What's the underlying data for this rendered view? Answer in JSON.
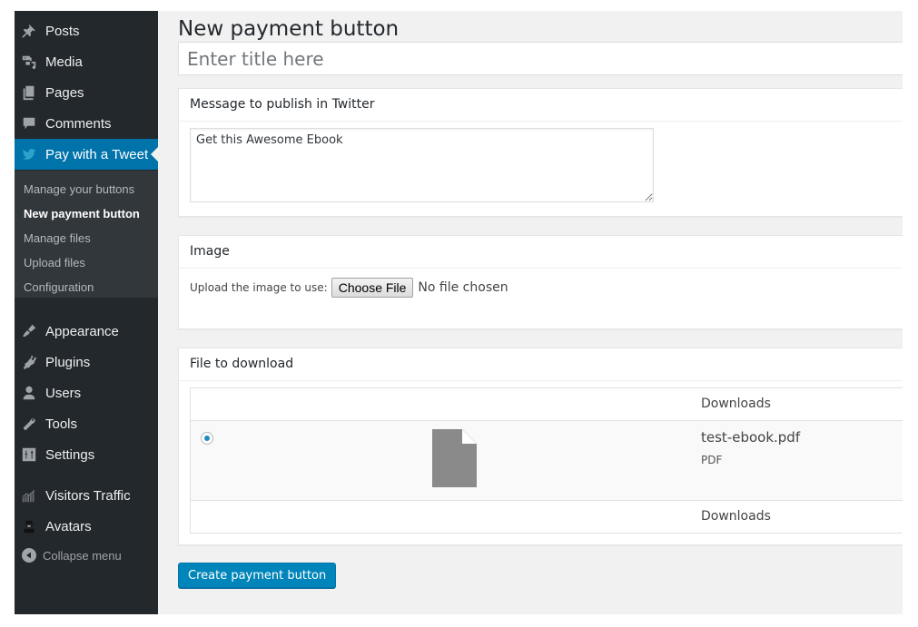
{
  "sidebar": {
    "menu": [
      {
        "label": "Posts",
        "icon": "pin-icon"
      },
      {
        "label": "Media",
        "icon": "media-icon"
      },
      {
        "label": "Pages",
        "icon": "pages-icon"
      },
      {
        "label": "Comments",
        "icon": "comment-icon"
      },
      {
        "label": "Pay with a Tweet",
        "icon": "twitter-icon",
        "active": true
      }
    ],
    "submenu": [
      {
        "label": "Manage your buttons"
      },
      {
        "label": "New payment button",
        "current": true
      },
      {
        "label": "Manage files"
      },
      {
        "label": "Upload files"
      },
      {
        "label": "Configuration"
      }
    ],
    "menu2": [
      {
        "label": "Appearance",
        "icon": "paintbrush-icon"
      },
      {
        "label": "Plugins",
        "icon": "plugin-icon"
      },
      {
        "label": "Users",
        "icon": "user-icon"
      },
      {
        "label": "Tools",
        "icon": "wrench-icon"
      },
      {
        "label": "Settings",
        "icon": "settings-icon"
      },
      {
        "label": "Visitors Traffic",
        "icon": "chart-icon"
      },
      {
        "label": "Avatars",
        "icon": "avatar-icon"
      }
    ],
    "collapse_label": "Collapse menu"
  },
  "main": {
    "page_title": "New payment button",
    "title_placeholder": "Enter title here",
    "twitter_box": {
      "heading": "Message to publish in Twitter",
      "message": "Get this Awesome Ebook"
    },
    "image_box": {
      "heading": "Image",
      "upload_label": "Upload the image to use:",
      "choose_file_label": "Choose File",
      "no_file_text": "No file chosen"
    },
    "file_box": {
      "heading": "File to download",
      "column_header": "Downloads",
      "column_footer": "Downloads",
      "files": [
        {
          "name": "test-ebook.pdf",
          "type": "PDF",
          "selected": true
        }
      ]
    },
    "create_button_label": "Create payment button"
  },
  "colors": {
    "sidebar_bg": "#23282d",
    "submenu_bg": "#32373c",
    "active_bg": "#0073aa",
    "primary_button": "#0085ba",
    "page_bg": "#f1f1f1"
  }
}
